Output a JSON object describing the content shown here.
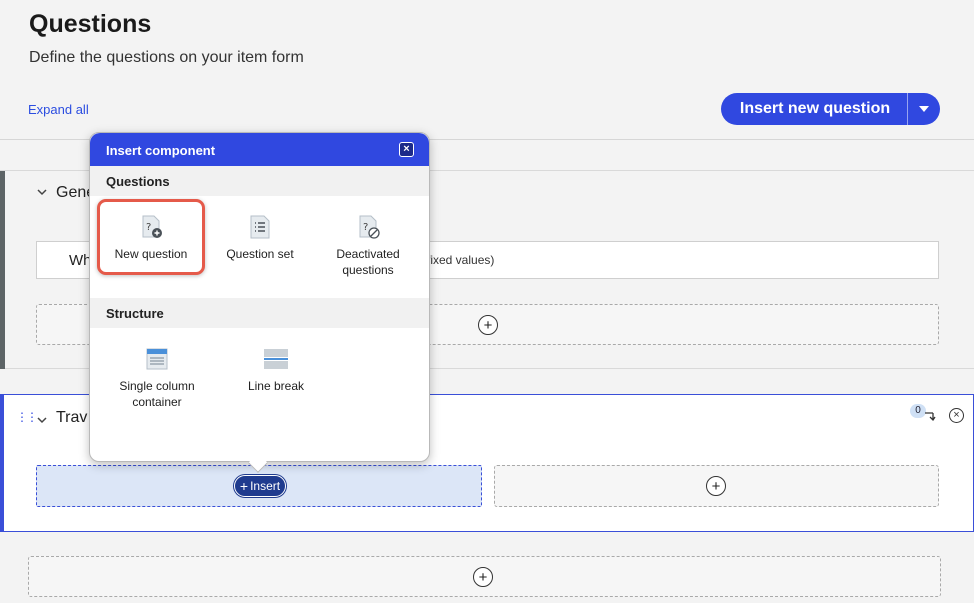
{
  "header": {
    "title": "Questions",
    "subtitle": "Define the questions on your item form",
    "expand_all": "Expand all",
    "insert_button": "Insert new question"
  },
  "section1": {
    "title": "Gene",
    "field_lead": "Wh",
    "field_tail": "fixed values)"
  },
  "section2": {
    "title": "Trav",
    "badge": "0",
    "insert_label": "Insert"
  },
  "popup": {
    "title": "Insert component",
    "questions_heading": "Questions",
    "structure_heading": "Structure",
    "items": {
      "new_question": "New question",
      "question_set": "Question set",
      "deactivated_questions_1": "Deactivated",
      "deactivated_questions_2": "questions",
      "single_column_1": "Single column",
      "single_column_2": "container",
      "line_break": "Line break"
    }
  },
  "colors": {
    "brand_blue": "#3048e0",
    "highlight_red": "#e55a4a"
  }
}
